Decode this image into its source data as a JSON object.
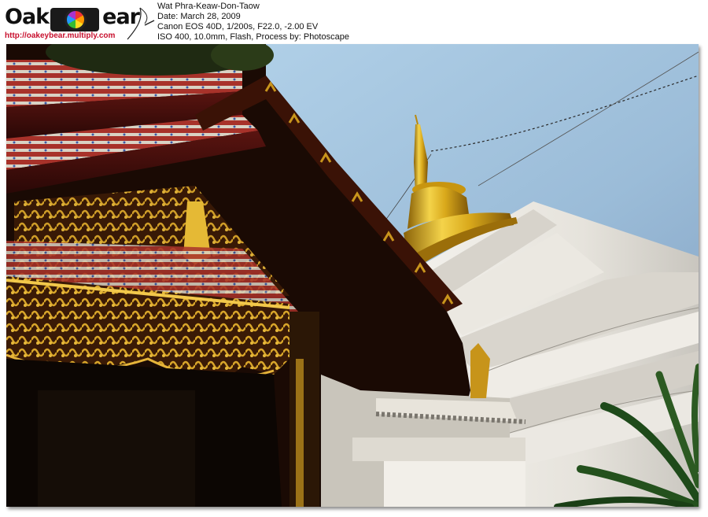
{
  "watermark": {
    "logo_text": "Oakey  ear",
    "url": "http://oakeybear.multiply.com"
  },
  "exif": {
    "title": "Wat Phra-Keaw-Don-Taow",
    "date": "Date: March 28, 2009",
    "camera": "Canon EOS 40D, 1/200s, F22.0, -2.00 EV",
    "settings": "ISO 400, 10.0mm, Flash, Process by: Photoscape"
  },
  "colors": {
    "sky": "#a9cde6",
    "gold": "#d4a017",
    "chedi_white": "#ece9e2",
    "roof_red": "#7a1a14"
  },
  "icons": [
    "camera-lens-icon",
    "swoosh-icon"
  ]
}
